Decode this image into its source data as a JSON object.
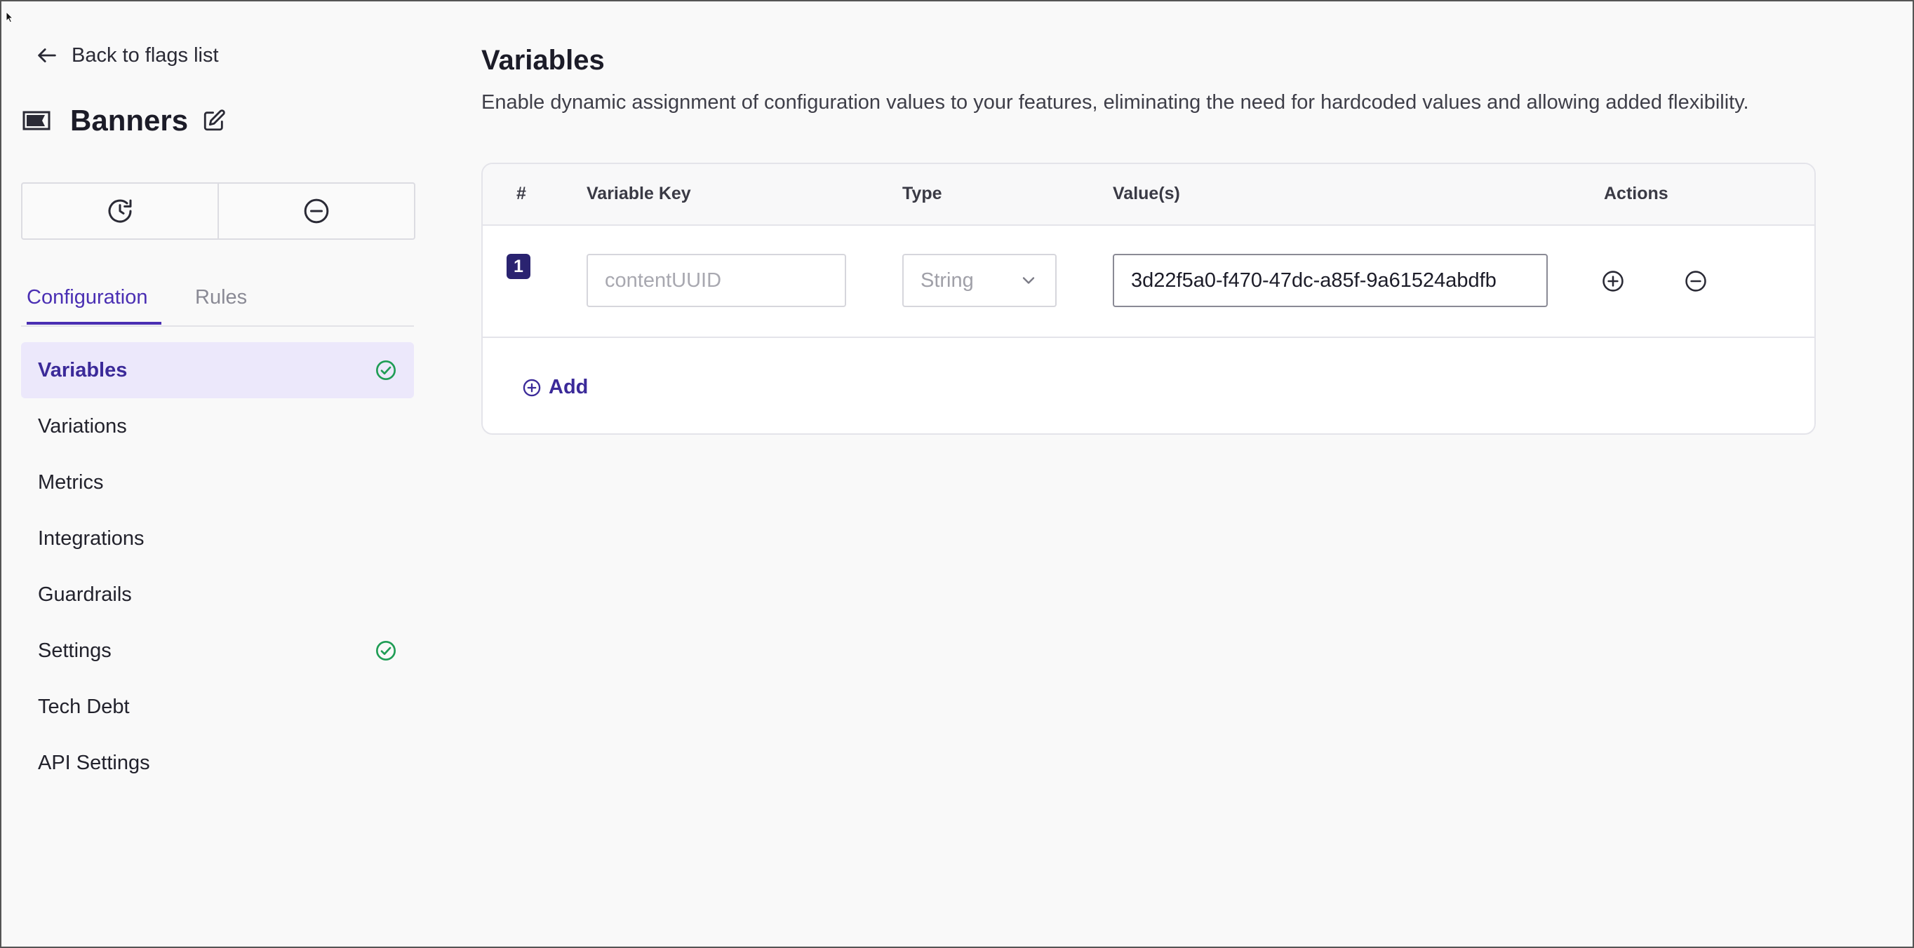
{
  "back_link": {
    "label": "Back to flags list"
  },
  "flag": {
    "name": "Banners"
  },
  "tabs": [
    {
      "label": "Configuration",
      "active": true
    },
    {
      "label": "Rules",
      "active": false
    }
  ],
  "nav": [
    {
      "label": "Variables",
      "active": true,
      "complete": true
    },
    {
      "label": "Variations",
      "active": false,
      "complete": false
    },
    {
      "label": "Metrics",
      "active": false,
      "complete": false
    },
    {
      "label": "Integrations",
      "active": false,
      "complete": false
    },
    {
      "label": "Guardrails",
      "active": false,
      "complete": false
    },
    {
      "label": "Settings",
      "active": false,
      "complete": true
    },
    {
      "label": "Tech Debt",
      "active": false,
      "complete": false
    },
    {
      "label": "API Settings",
      "active": false,
      "complete": false
    }
  ],
  "main": {
    "title": "Variables",
    "description": "Enable dynamic assignment of configuration values to your features, eliminating the need for hardcoded values and allowing added flexibility."
  },
  "table": {
    "headers": {
      "num": "#",
      "key": "Variable Key",
      "type": "Type",
      "values": "Value(s)",
      "actions": "Actions"
    },
    "rows": [
      {
        "num": "1",
        "key_placeholder": "contentUUID",
        "type": "String",
        "value": "3d22f5a0-f470-47dc-a85f-9a61524abdfb"
      }
    ],
    "add_label": "Add"
  },
  "colors": {
    "accent": "#4a2fb3",
    "success": "#1f9d55",
    "badge": "#2a2370"
  }
}
